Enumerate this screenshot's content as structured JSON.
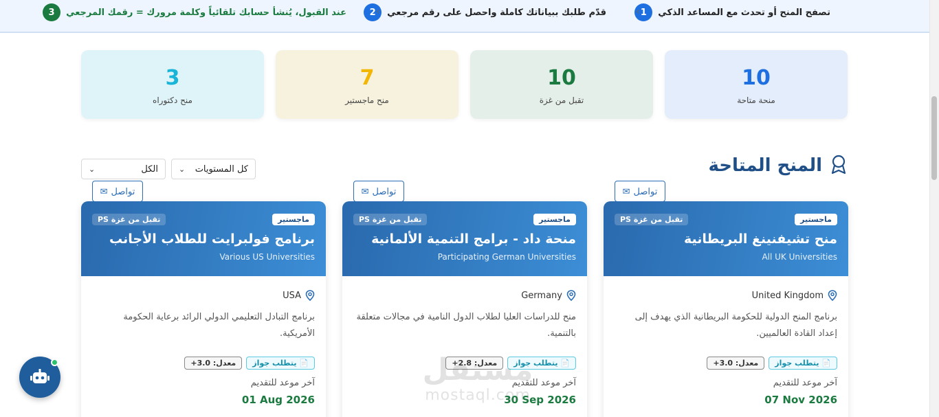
{
  "colors": {
    "primary": "#1f4f86",
    "step_blue": "#1e6fe0",
    "step_green": "#1a7a3f",
    "green_text": "#1a7a3f"
  },
  "steps": [
    {
      "num": "1",
      "text": "تصفح المنح أو تحدث مع المساعد الذكي"
    },
    {
      "num": "2",
      "text": "قدّم طلبك ببياناتك كاملة واحصل على رقم مرجعي"
    },
    {
      "num": "3",
      "text": "عند القبول، يُنشأ حسابك تلقائياً وكلمة مرورك = رقمك المرجعي"
    }
  ],
  "stats": [
    {
      "value": "10",
      "label": "منحة متاحة"
    },
    {
      "value": "10",
      "label": "تقبل من غزة"
    },
    {
      "value": "7",
      "label": "منح ماجستير"
    },
    {
      "value": "3",
      "label": "منح دكتوراه"
    }
  ],
  "section": {
    "title": "المنح المتاحة",
    "filter_level": "كل المستويات",
    "filter_all": "الكل"
  },
  "cards": [
    {
      "level": "ماجستير",
      "gaza": "تقبل من غزة",
      "title": "منح تشيفنينغ البريطانية",
      "subtitle": "All UK Universities",
      "country": "United Kingdom",
      "desc": "برنامج المنح الدولية للحكومة البريطانية الذي يهدف إلى إعداد القادة العالميين.",
      "passport": "يتطلب جواز",
      "gpa": "معدل: 3.0+",
      "deadline_label": "آخر موعد للتقديم",
      "deadline": "07 Nov 2026",
      "contact": "تواصل"
    },
    {
      "level": "ماجستير",
      "gaza": "تقبل من غزة",
      "title": "منحة داد - برامج التنمية الألمانية",
      "subtitle": "Participating German Universities",
      "country": "Germany",
      "desc": "منح للدراسات العليا لطلاب الدول النامية في مجالات متعلقة بالتنمية.",
      "passport": "يتطلب جواز",
      "gpa": "معدل: 2.8+",
      "deadline_label": "آخر موعد للتقديم",
      "deadline": "30 Sep 2026",
      "contact": "تواصل"
    },
    {
      "level": "ماجستير",
      "gaza": "تقبل من غزة",
      "title": "برنامج فولبرايت للطلاب الأجانب",
      "subtitle": "Various US Universities",
      "country": "USA",
      "desc": "برنامج التبادل التعليمي الدولي الرائد برعاية الحكومة الأمريكية.",
      "passport": "يتطلب جواز",
      "gpa": "معدل: 3.0+",
      "deadline_label": "آخر موعد للتقديم",
      "deadline": "01 Aug 2026",
      "contact": "تواصل"
    }
  ],
  "watermark": {
    "logo": "مستقل",
    "text": "mostaql.com"
  }
}
